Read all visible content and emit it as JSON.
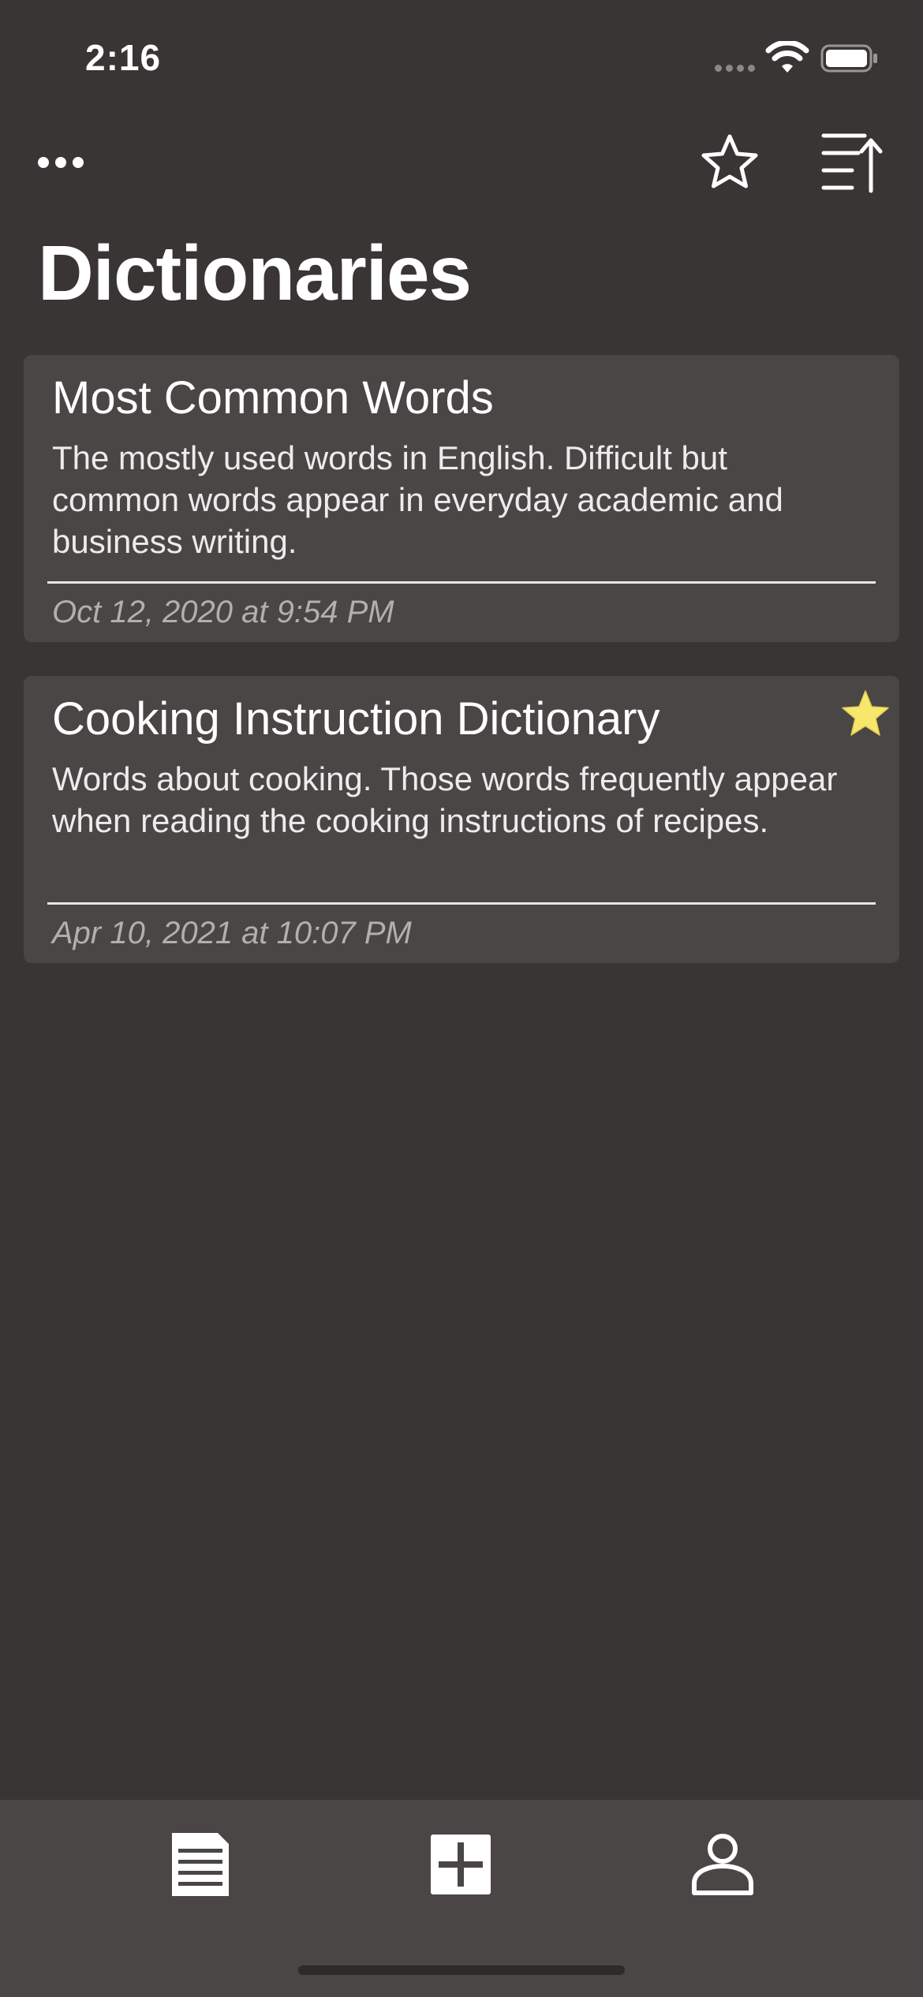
{
  "status_bar": {
    "time": "2:16"
  },
  "toolbar": {
    "more_icon": "ellipsis-icon",
    "favorites_icon": "star-outline-icon",
    "sort_icon": "sort-icon"
  },
  "page": {
    "title": "Dictionaries"
  },
  "dictionaries": [
    {
      "title": "Most Common Words",
      "description": "The mostly used words in English. Difficult but common words appear in everyday academic and business writing.",
      "date": "Oct 12, 2020 at 9:54 PM",
      "favorite": false
    },
    {
      "title": "Cooking Instruction Dictionary",
      "description": "Words about cooking. Those words frequently appear when reading the cooking instructions of recipes.",
      "date": "Apr 10, 2021 at 10:07 PM",
      "favorite": true
    }
  ],
  "tab_bar": {
    "items": [
      {
        "icon": "document-list-icon"
      },
      {
        "icon": "add-square-icon"
      },
      {
        "icon": "person-icon"
      }
    ]
  },
  "colors": {
    "background": "#393534",
    "card": "#4a4645",
    "favorite_star": "#f7e76d",
    "date_text": "#b3afae"
  }
}
